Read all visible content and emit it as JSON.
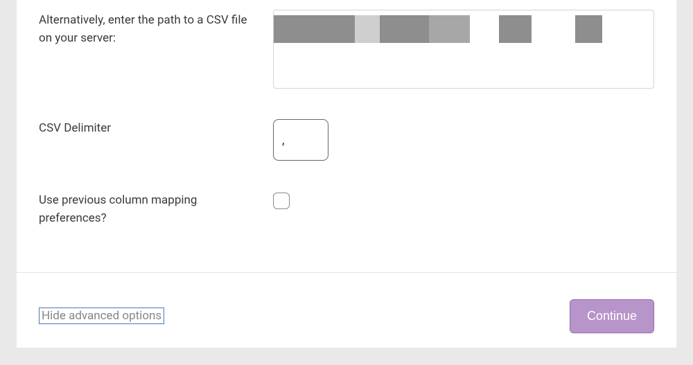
{
  "form": {
    "csv_path_label": "Alternatively, enter the path to a CSV file on your server:",
    "csv_path_value": "",
    "delimiter_label": "CSV Delimiter",
    "delimiter_value": ",",
    "mapping_label": "Use previous column mapping preferences?",
    "mapping_checked": false
  },
  "footer": {
    "hide_advanced_label": "Hide advanced options",
    "continue_label": "Continue"
  }
}
